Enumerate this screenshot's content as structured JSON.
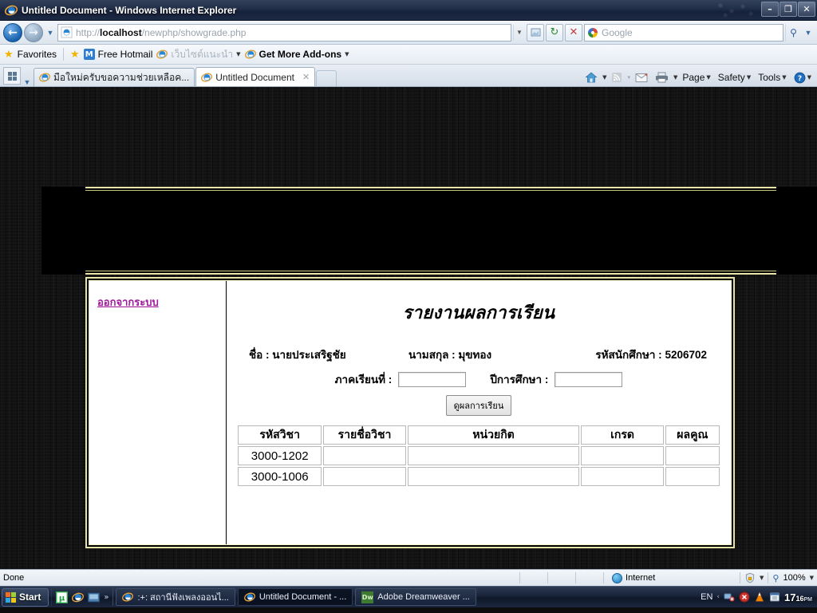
{
  "window": {
    "title": "Untitled Document - Windows Internet Explorer",
    "minimize_label": "–",
    "restore_label": "❐",
    "close_label": "✕"
  },
  "nav": {
    "back_icon": "back-arrow-icon",
    "forward_icon": "forward-arrow-icon",
    "recent_caret": "▼",
    "url_prefix": "http://",
    "url_host": "localhost",
    "url_path": "/newphp/showgrade.php",
    "url_full": "http://localhost/newphp/showgrade.php",
    "address_dropdown": "▼",
    "compat_icon": "⎙",
    "refresh_icon": "↻",
    "stop_icon": "✕",
    "search_placeholder": "Google",
    "search_go_icon": "⚲",
    "search_dropdown": "▼"
  },
  "favorites": {
    "label": "Favorites",
    "star_icon": "★",
    "add_icon": "★",
    "items": [
      {
        "label": "Free Hotmail",
        "icon": "hotmail-icon",
        "caret": ""
      },
      {
        "label": "เว็บไซต์แนะนำ",
        "icon": "ie-icon",
        "caret": "▼"
      },
      {
        "label": "Get More Add-ons",
        "icon": "ie-icon",
        "caret": "▼"
      }
    ]
  },
  "tabs": {
    "quicktabs_icon": "quick-tabs-icon",
    "tablist_caret": "▼",
    "items": [
      {
        "label": "มือใหม่ครับขอความช่วยเหลือค...",
        "active": false
      },
      {
        "label": "Untitled Document",
        "active": true
      }
    ],
    "close_icon": "✕",
    "new_tab_label": ""
  },
  "commandbar": {
    "home_icon": "home-icon",
    "home_caret": "▼",
    "feeds_icon": "☲",
    "feeds_caret": "▾",
    "mail_icon": "✉",
    "print_icon": "⎙",
    "print_caret": "▼",
    "page_label": "Page",
    "page_caret": "▼",
    "safety_label": "Safety",
    "safety_caret": "▼",
    "tools_label": "Tools",
    "tools_caret": "▼",
    "help_icon": "?",
    "help_caret": "▼",
    "overflow_icon": "»"
  },
  "page": {
    "sidebar": {
      "logout_label": "ออกจากระบบ"
    },
    "title": "รายงานผลการเรียน",
    "student": {
      "name_label": "ชื่อ :",
      "name_value": "นายประเสริฐชัย",
      "surname_label": "นามสกุล :",
      "surname_value": "มุขทอง",
      "id_label": "รหัสนักศึกษา :",
      "id_value": "5206702"
    },
    "form": {
      "term_label": "ภาคเรียนที่ :",
      "term_value": "",
      "year_label": "ปีการศึกษา :",
      "year_value": "",
      "submit_label": "ดูผลการเรียน"
    },
    "table": {
      "headers": [
        "รหัสวิชา",
        "รายชื่อวิชา",
        "หน่วยกิต",
        "เกรด",
        "ผลคูณ"
      ],
      "rows": [
        {
          "code": "3000-1202",
          "name": "",
          "credits": "",
          "grade": "",
          "product": ""
        },
        {
          "code": "3000-1006",
          "name": "",
          "credits": "",
          "grade": "",
          "product": ""
        }
      ]
    }
  },
  "statusbar": {
    "status": "Done",
    "zone_label": "Internet",
    "zone_icon": "globe-icon",
    "protected_icon": "🔒",
    "protected_caret": "▼",
    "zoom_icon": "⚲",
    "zoom_level": "100%",
    "zoom_caret": "▼"
  },
  "taskbar": {
    "start_label": "Start",
    "quicklaunch": [
      {
        "name": "utorrent-icon"
      },
      {
        "name": "ie-icon"
      },
      {
        "name": "media-icon"
      }
    ],
    "overflow_icon": "»",
    "items": [
      {
        "label": ":+: สถานีฟังเพลงออนไ...",
        "icon": "ie-icon",
        "active": false
      },
      {
        "label": "Untitled Document - ...",
        "icon": "ie-icon",
        "active": true
      },
      {
        "label": "Adobe Dreamweaver ...",
        "icon": "dreamweaver-icon",
        "active": false
      }
    ],
    "tray": {
      "language": "EN",
      "expand_icon": "‹",
      "icons": [
        "network-icon",
        "shield-icon",
        "vlc-icon",
        "update-icon"
      ],
      "time_hours": "17",
      "time_mins": "16",
      "time_ampm": "PM"
    }
  },
  "colors": {
    "gold_border": "#e8e4a8",
    "link_purple": "#a0189a",
    "banner_black": "#000000"
  }
}
